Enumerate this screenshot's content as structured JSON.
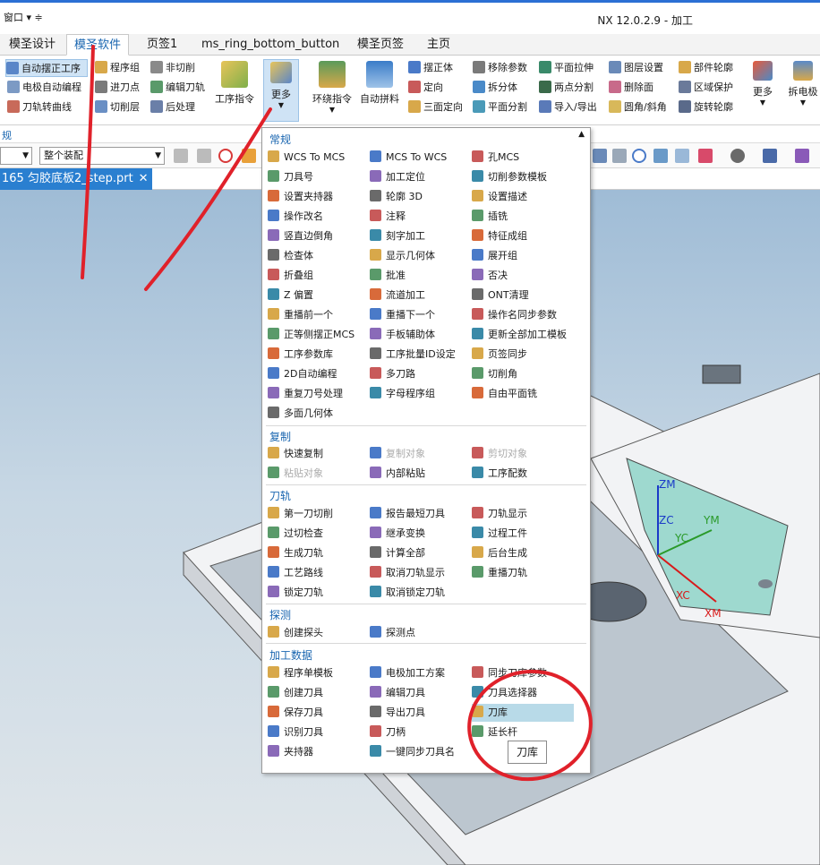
{
  "titlebar": {
    "window_menu": "窗口 ▾ ≑",
    "app_title": "NX 12.0.2.9 - 加工"
  },
  "tabs": [
    {
      "label": "模圣设计"
    },
    {
      "label": "模圣软件"
    },
    {
      "label": "页签1"
    },
    {
      "label": "ms_ring_bottom_button"
    },
    {
      "label": "模圣页签"
    },
    {
      "label": "主页"
    }
  ],
  "ribbon": {
    "small_col1": [
      "自动摆正工序",
      "电极自动编程",
      "刀轨转曲线"
    ],
    "small_col2": [
      "程序组",
      "进刀点",
      "切削层"
    ],
    "small_col3": [
      "非切削",
      "编辑刀轨",
      "后处理"
    ],
    "big_gongxu": "工序指令",
    "big_more": "更多",
    "big_huanrao": "环绕指令",
    "big_zidong": "自动拼料",
    "col4": [
      "摆正体",
      "定向",
      "三面定向"
    ],
    "col5": [
      "移除参数",
      "拆分体",
      "平面分割"
    ],
    "col6": [
      "平面拉伸",
      "两点分割",
      "导入/导出"
    ],
    "col7": [
      "图层设置",
      "删除面",
      "圆角/斜角"
    ],
    "col8": [
      "部件轮廓",
      "区域保护",
      "旋转轮廓"
    ],
    "big_more2": "更多",
    "big_chai": "拆电极"
  },
  "group_label": "规",
  "toolbar": {
    "dropdown1": "",
    "dropdown2": "整个装配"
  },
  "doc_tab": {
    "label": "165 匀胶底板2_step.prt"
  },
  "axes": {
    "zm": "ZM",
    "zc": "ZC",
    "ym": "YM",
    "yc": "YC",
    "xc": "XC",
    "xm": "XM"
  },
  "menu": {
    "sections": {
      "changgui": "常规",
      "fuzhi": "复制",
      "daogui": "刀轨",
      "tance": "探测",
      "jiagong": "加工数据"
    },
    "changgui_items": [
      [
        "WCS To MCS",
        "MCS To WCS",
        "孔MCS"
      ],
      [
        "刀具号",
        "加工定位",
        "切削参数模板"
      ],
      [
        "设置夹持器",
        "轮廓 3D",
        "设置描述"
      ],
      [
        "操作改名",
        "注释",
        "插铣"
      ],
      [
        "竖直边倒角",
        "刻字加工",
        "特征成组"
      ],
      [
        "检查体",
        "显示几何体",
        "展开组"
      ],
      [
        "折叠组",
        "批准",
        "否决"
      ],
      [
        "Z 偏置",
        "流道加工",
        "ONT清理"
      ],
      [
        "重播前一个",
        "重播下一个",
        "操作名同步参数"
      ],
      [
        "正等侧摆正MCS",
        "手板辅助体",
        "更新全部加工模板"
      ],
      [
        "工序参数库",
        "工序批量ID设定",
        "页签同步"
      ],
      [
        "2D自动编程",
        "多刀路",
        "切削角"
      ],
      [
        "重复刀号处理",
        "字母程序组",
        "自由平面铣"
      ],
      [
        "多面几何体",
        "",
        ""
      ]
    ],
    "fuzhi_items": [
      [
        "快速复制",
        "复制对象",
        "剪切对象"
      ],
      [
        "粘贴对象",
        "内部粘贴",
        "工序配数"
      ]
    ],
    "daogui_items": [
      [
        "第一刀切削",
        "报告最短刀具",
        "刀轨显示"
      ],
      [
        "过切检查",
        "继承变换",
        "过程工件"
      ],
      [
        "生成刀轨",
        "计算全部",
        "后台生成"
      ],
      [
        "工艺路线",
        "取消刀轨显示",
        "重播刀轨"
      ],
      [
        "锁定刀轨",
        "取消锁定刀轨",
        ""
      ]
    ],
    "tance_items": [
      [
        "创建探头",
        "探测点",
        ""
      ]
    ],
    "jiagong_items": [
      [
        "程序单模板",
        "电极加工方案",
        "同步刀库参数"
      ],
      [
        "创建刀具",
        "编辑刀具",
        "刀具选择器"
      ],
      [
        "保存刀具",
        "导出刀具",
        "刀库"
      ],
      [
        "识别刀具",
        "刀柄",
        "延长杆"
      ],
      [
        "夹持器",
        "一键同步刀具名",
        ""
      ]
    ]
  },
  "tooltip": "刀库",
  "colors": {
    "accent": "#1a66b0",
    "highlight": "#b8dae8",
    "doc_tab": "#2a7fd0",
    "annotation_red": "#e0212a"
  }
}
